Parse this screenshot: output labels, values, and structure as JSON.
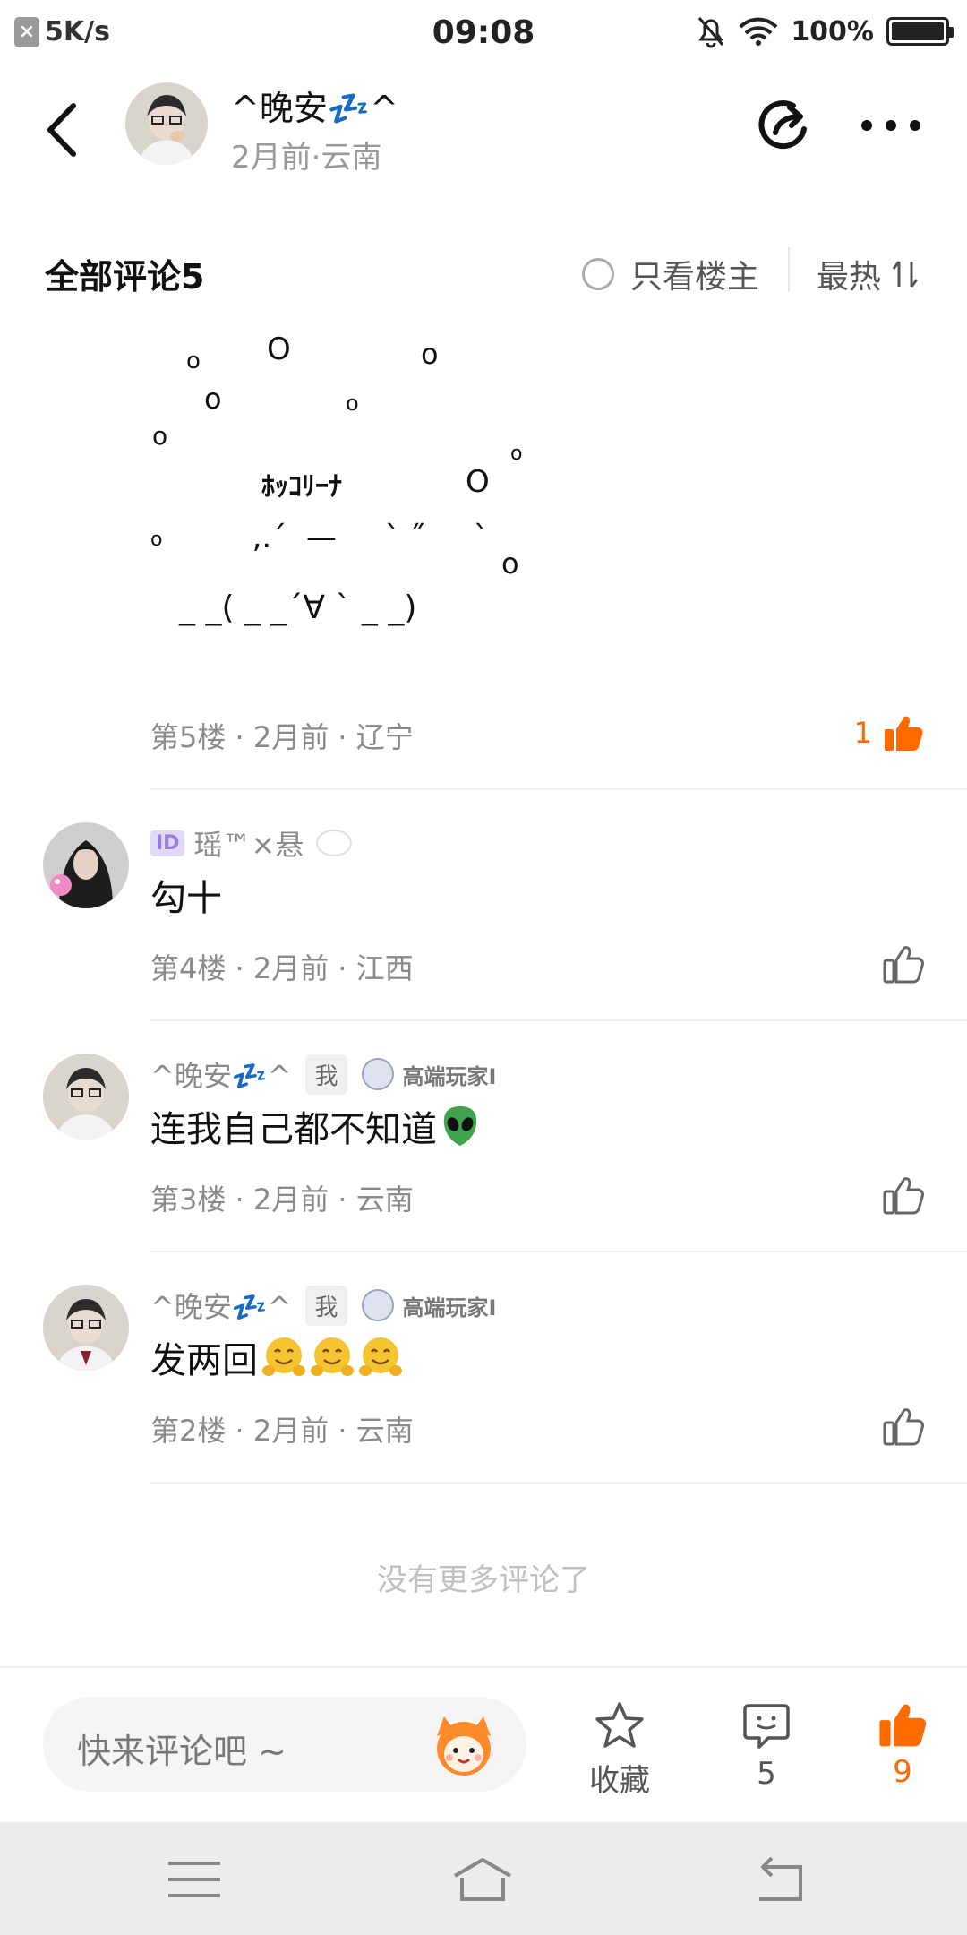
{
  "status_bar": {
    "net_speed": "5K/s",
    "time": "09:08",
    "battery": "100%",
    "battery_level": 1.0
  },
  "header": {
    "author_name": "^晚安💤^",
    "author_meta": "2月前·云南"
  },
  "comments_header": {
    "title": "全部评论5",
    "only_op_label": "只看楼主",
    "sort_label": "最热"
  },
  "floor5": {
    "ascii_text": "ﾎｯｺﾘｰﾅ",
    "meta": "第5楼 · 2月前 · 辽宁",
    "like_count": "1"
  },
  "comments": [
    {
      "id_badge": "ID",
      "username": "瑶™×悬",
      "text": "勾十",
      "meta": "第4楼 · 2月前 · 江西"
    },
    {
      "username": "^晚安💤^",
      "me_tag": "我",
      "badge_label": "高端玩家I",
      "text": "连我自己都不知道",
      "meta": "第3楼 · 2月前 · 云南"
    },
    {
      "username": "^晚安💤^",
      "me_tag": "我",
      "badge_label": "高端玩家I",
      "text": "发两回",
      "meta": "第2楼 · 2月前 · 云南"
    }
  ],
  "no_more": "没有更多评论了",
  "bottom_bar": {
    "comment_placeholder": "快来评论吧 ~",
    "favorite_label": "收藏",
    "comment_count": "5",
    "like_count": "9"
  },
  "colors": {
    "accent": "#ff6a00",
    "muted": "#8a8a8a"
  }
}
